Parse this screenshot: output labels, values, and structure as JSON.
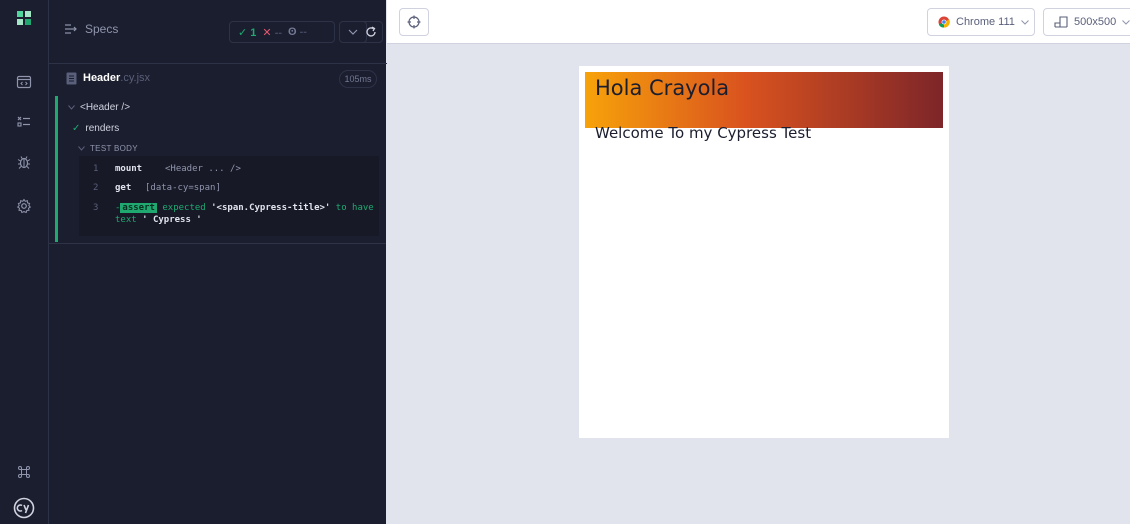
{
  "reporter": {
    "specs_label": "Specs",
    "stats": {
      "passed": "1",
      "failed": "--",
      "pending": "--"
    },
    "file": {
      "name": "Header",
      "ext": ".cy.jsx",
      "duration": "105ms"
    },
    "suite_title": "<Header />",
    "test_title": "renders",
    "test_body_label": "TEST BODY",
    "commands": [
      {
        "num": "1",
        "name": "mount",
        "msg": "<Header ... />"
      },
      {
        "num": "2",
        "name": "get",
        "msg": "[data-cy=span]"
      },
      {
        "num": "3",
        "badge": "assert",
        "expected": "expected",
        "subject": "'<span.Cypress-title>'",
        "to_have": "to have",
        "text_kw": "text",
        "value": "' Cypress '"
      }
    ]
  },
  "topbar": {
    "browser": "Chrome 111",
    "viewport": "500x500"
  },
  "app": {
    "title": "Hola Crayola",
    "subtitle": "Welcome To my Cypress Test"
  },
  "colors": {
    "pass": "#1fa971",
    "fail": "#e45770",
    "nav_bg": "#1b1e2e",
    "preview_bg": "#e1e3ed"
  }
}
